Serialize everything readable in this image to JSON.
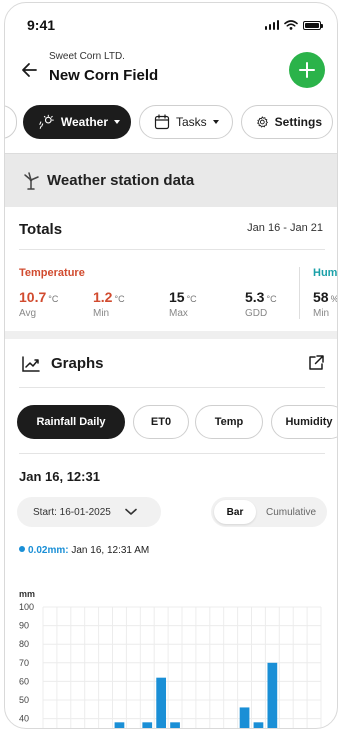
{
  "status_bar": {
    "time": "9:41"
  },
  "header": {
    "company": "Sweet Corn LTD.",
    "field_name": "New Corn Field"
  },
  "tabs": [
    {
      "label": "Weather",
      "active": true,
      "icon": "rain-sun-icon",
      "has_caret": true
    },
    {
      "label": "Tasks",
      "active": false,
      "icon": "calendar-icon",
      "has_caret": true
    },
    {
      "label": "Settings",
      "active": false,
      "icon": "gear-icon",
      "has_caret": false
    }
  ],
  "station": {
    "title": "Weather station data",
    "icon": "windmill-icon"
  },
  "totals": {
    "title": "Totals",
    "date_range": "Jan 16 - Jan 21",
    "temperature": {
      "label": "Temperature",
      "color": "#d14b2f",
      "metrics": [
        {
          "value": "10.7",
          "unit": "°C",
          "caption": "Avg",
          "color": "#d14b2f"
        },
        {
          "value": "1.2",
          "unit": "°C",
          "caption": "Min",
          "color": "#d14b2f"
        },
        {
          "value": "15",
          "unit": "°C",
          "caption": "Max",
          "color": "#1b1b1b"
        },
        {
          "value": "5.3",
          "unit": "°C",
          "caption": "GDD",
          "color": "#1b1b1b"
        }
      ]
    },
    "humidity": {
      "label": "Humi",
      "color": "#1aa0a8",
      "metrics": [
        {
          "value": "58",
          "unit": "%",
          "caption": "Min"
        }
      ]
    }
  },
  "graphs": {
    "title": "Graphs",
    "chips": [
      {
        "label": "Rainfall Daily",
        "active": true
      },
      {
        "label": "ET0",
        "active": false
      },
      {
        "label": "Temp",
        "active": false
      },
      {
        "label": "Humidity",
        "active": false
      }
    ],
    "date": "Jan 16, 12:31",
    "start_select": "Start: 16-01-2025",
    "toggle": {
      "bar": "Bar",
      "cumulative": "Cumulative",
      "selected": "Bar"
    },
    "reading": {
      "amount": "0.02mm:",
      "time": "Jan 16, 12:31 AM"
    }
  },
  "chart_data": {
    "type": "bar",
    "ylabel": "mm",
    "ylim": [
      0,
      100
    ],
    "y_ticks": [
      "100",
      "90",
      "80",
      "70",
      "60",
      "50",
      "40"
    ],
    "bar_color": "#1a8fd6",
    "grid": true,
    "series": [
      {
        "values": [
          0,
          0,
          0,
          0,
          0,
          38,
          0,
          38,
          62,
          38,
          0,
          0,
          0,
          0,
          46,
          38,
          70,
          0,
          0,
          0
        ]
      }
    ]
  }
}
